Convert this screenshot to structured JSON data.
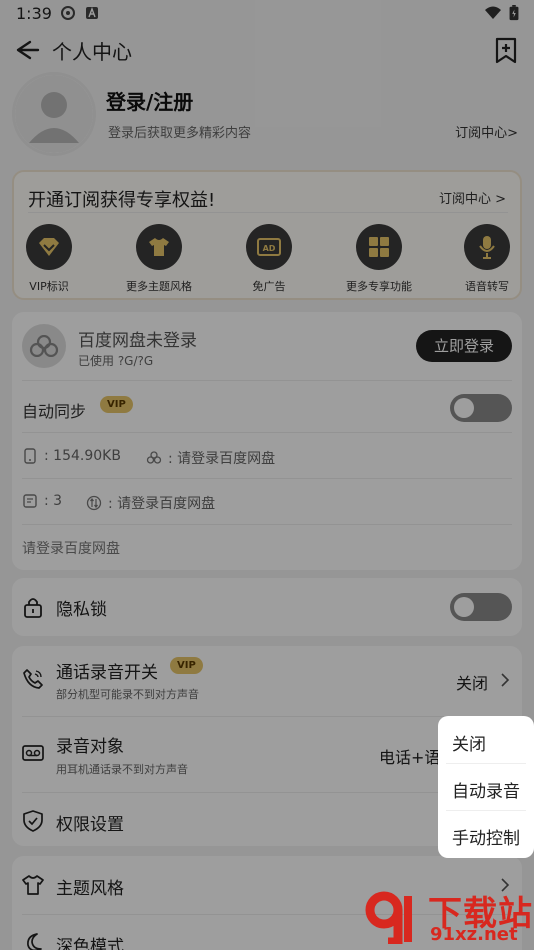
{
  "status_bar": {
    "time": "1:39"
  },
  "header": {
    "title": "个人中心"
  },
  "profile": {
    "title": "登录/注册",
    "subtitle": "登录后获取更多精彩内容",
    "subscribe_link": "订阅中心>"
  },
  "vip_card": {
    "title": "开通订阅获得专享权益!",
    "link": "订阅中心 >",
    "features": [
      {
        "label": "VIP标识",
        "icon": "vip-badge-icon"
      },
      {
        "label": "更多主题风格",
        "icon": "shirt-icon"
      },
      {
        "label": "免广告",
        "icon": "ad-icon"
      },
      {
        "label": "更多专享功能",
        "icon": "grid-icon"
      },
      {
        "label": "语音转写",
        "icon": "mic-icon"
      }
    ]
  },
  "cloud": {
    "title": "百度网盘未登录",
    "used": "已使用 ?G/?G",
    "login_button": "立即登录",
    "sync_label": "自动同步",
    "vip_badge": "VIP",
    "local_size": ": 154.90KB",
    "cloud_size": ": 请登录百度网盘",
    "file_count": ": 3",
    "sync_status": ": 请登录百度网盘",
    "hint": "请登录百度网盘"
  },
  "privacy": {
    "label": "隐私锁"
  },
  "record": {
    "call_label": "通话录音开关",
    "call_badge": "VIP",
    "call_sub": "部分机型可能录不到对方声音",
    "call_value": "关闭",
    "target_label": "录音对象",
    "target_sub": "用耳机通话录不到对方声音",
    "target_value": "电话+语",
    "permission_label": "权限设置"
  },
  "theme": {
    "label": "主题风格",
    "dark_label": "深色模式"
  },
  "popup": {
    "items": [
      "关闭",
      "自动录音",
      "手动控制"
    ]
  },
  "watermark": {
    "title": "下载站",
    "url": "91xz.net"
  }
}
